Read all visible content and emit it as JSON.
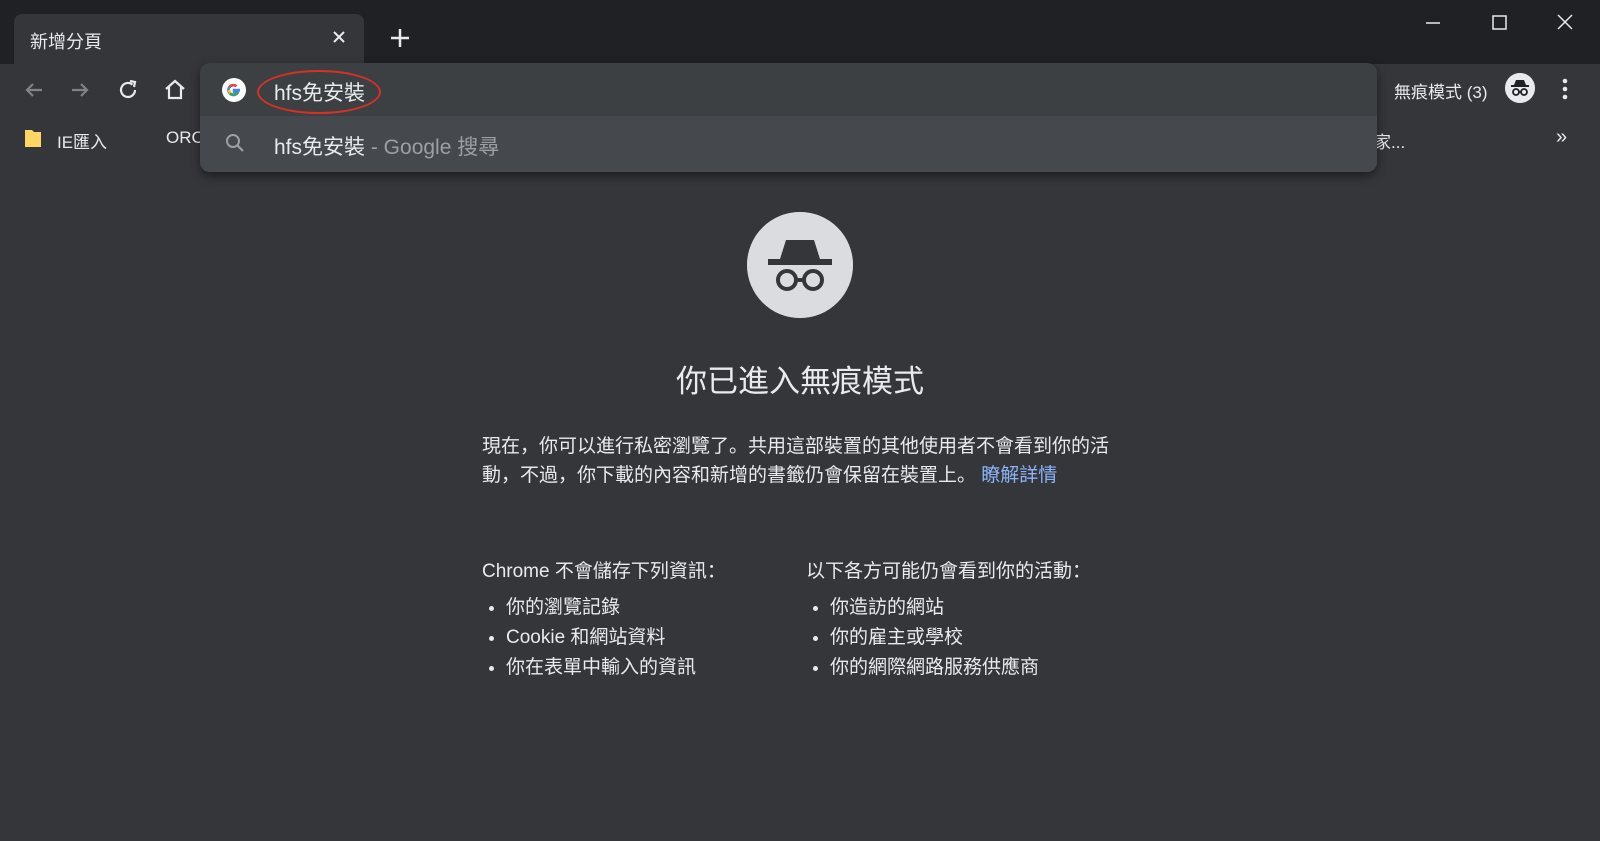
{
  "tab": {
    "title": "新增分頁"
  },
  "omnibox": {
    "input_value": "hfs免安裝",
    "suggestion": {
      "query": "hfs免安裝",
      "sub": " - Google 搜尋"
    }
  },
  "toolbar": {
    "incognito_label": "無痕模式 (3)"
  },
  "bookmarks": {
    "items": [
      "IE匯入",
      "ORC"
    ],
    "overflow_fragment": "家...",
    "more": "»"
  },
  "content": {
    "heading": "你已進入無痕模式",
    "description": "現在，你可以進行私密瀏覽了。共用這部裝置的其他使用者不會看到你的活動，不過，你下載的內容和新增的書籤仍會保留在裝置上。",
    "learn_more": "瞭解詳情",
    "col1": {
      "title": "Chrome 不會儲存下列資訊：",
      "items": [
        "你的瀏覽記錄",
        "Cookie 和網站資料",
        "你在表單中輸入的資訊"
      ]
    },
    "col2": {
      "title": "以下各方可能仍會看到你的活動：",
      "items": [
        "你造訪的網站",
        "你的雇主或學校",
        "你的網際網路服務供應商"
      ]
    }
  },
  "icons": {
    "back": "arrow-back-icon",
    "forward": "arrow-forward-icon",
    "reload": "reload-icon",
    "home": "home-icon",
    "google": "google-g-icon",
    "search": "search-icon",
    "incognito": "incognito-icon",
    "menu": "more-vert-icon",
    "folder": "folder-icon"
  },
  "colors": {
    "frame": "#202124",
    "surface": "#35363a",
    "omnibox": "#3c4043",
    "text": "#e8eaed",
    "muted": "#9aa0a6",
    "link": "#8ab4f8",
    "highlight": "#d93025"
  }
}
